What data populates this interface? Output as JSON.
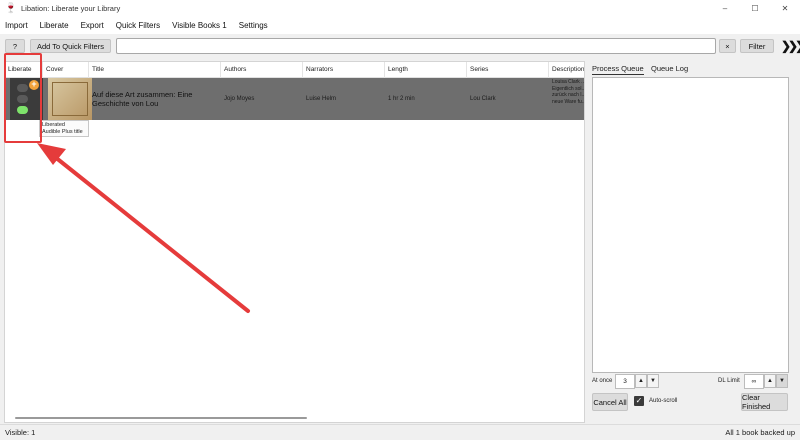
{
  "window": {
    "title": "Libation: Liberate your Library",
    "icon": "libation-glass-icon",
    "controls": [
      "–",
      "☐",
      "✕"
    ]
  },
  "menu": [
    "Import",
    "Liberate",
    "Export",
    "Quick Filters",
    "Visible Books 1",
    "Settings"
  ],
  "toolbar": {
    "help_label": "?",
    "add_quick_filter_label": "Add To Quick Filters",
    "search_value": "",
    "clear_label": "×",
    "filter_label": "Filter",
    "expand_label": "❯❯❯"
  },
  "grid": {
    "columns": [
      "Liberate",
      "Cover",
      "Title",
      "Authors",
      "Narrators",
      "Length",
      "Series",
      "Description"
    ],
    "rows": [
      {
        "title": "Auf diese Art zusammen: Eine Geschichte von Lou",
        "authors": "Jojo Moyes",
        "narrators": "Luise Helm",
        "length": "1 hr 2 min",
        "series": "Lou Clark",
        "description": "Louisa Clark ... Eigentlich sol... zurück nach l... neue Ware fu..."
      }
    ],
    "tooltip": [
      "Liberated",
      "Audible Plus title"
    ]
  },
  "process_panel": {
    "tabs": [
      "Process Queue",
      "Queue Log"
    ],
    "at_once_label": "At once",
    "at_once_value": "3",
    "dl_limit_label": "DL Limit",
    "dl_limit_value": "∞",
    "cancel_all_label": "Cancel All",
    "auto_scroll_label": "Auto-scroll",
    "clear_finished_label": "Clear Finished"
  },
  "status": {
    "visible": "Visible: 1",
    "backup": "All 1 book backed up"
  },
  "colors": {
    "row_selected": "#6e6e6e",
    "liberate_bg": "#3b3b3b",
    "light_green": "#7ee36b",
    "badge_orange": "#f2a23a",
    "annotation_red": "#e53b3b"
  }
}
